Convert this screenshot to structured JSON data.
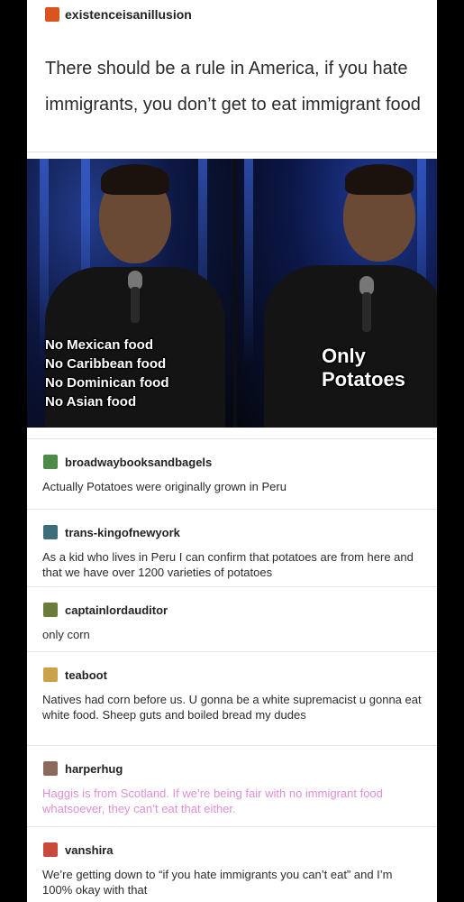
{
  "post": {
    "op": {
      "username": "existenceisanillusion",
      "avatar_color": "#d9541e",
      "text": "There should be a rule in America, if you hate immigrants, you don’t get to eat immigrant food"
    },
    "meme": {
      "left_caption": [
        "No Mexican food",
        "No Caribbean food",
        "No Dominican food",
        "No Asian food"
      ],
      "right_caption": [
        "Only",
        "Potatoes"
      ]
    },
    "reblogs": [
      {
        "username": "broadwaybooksandbagels",
        "avatar_color": "#4f8a4a",
        "text": "Actually Potatoes were originally grown in Peru",
        "text_color": "#2b2b2b"
      },
      {
        "username": "trans-kingofnewyork",
        "avatar_color": "#3d6e7a",
        "text": "As a kid who lives in Peru I can confirm that potatoes are from here and that we have over 1200 varieties of potatoes",
        "text_color": "#2b2b2b"
      },
      {
        "username": "captainlordauditor",
        "avatar_color": "#6a7b3a",
        "text": "only corn",
        "text_color": "#2b2b2b"
      },
      {
        "username": "teaboot",
        "avatar_color": "#c9a24a",
        "text": "Natives had corn before us. U gonna be a white supremacist u gonna eat white food. Sheep guts and boiled bread my dudes",
        "text_color": "#2b2b2b"
      },
      {
        "username": "harperhug",
        "avatar_color": "#8a6a5a",
        "text": "Haggis is from Scotland. If we’re being fair with no immigrant food whatsoever, they can’t eat that either.",
        "text_color": "#e08fd4"
      },
      {
        "username": "vanshira",
        "avatar_color": "#c84a3a",
        "text": "We’re getting down to “if you hate immigrants you can’t eat” and I’m 100% okay with that",
        "text_color": "#2b2b2b"
      }
    ]
  }
}
